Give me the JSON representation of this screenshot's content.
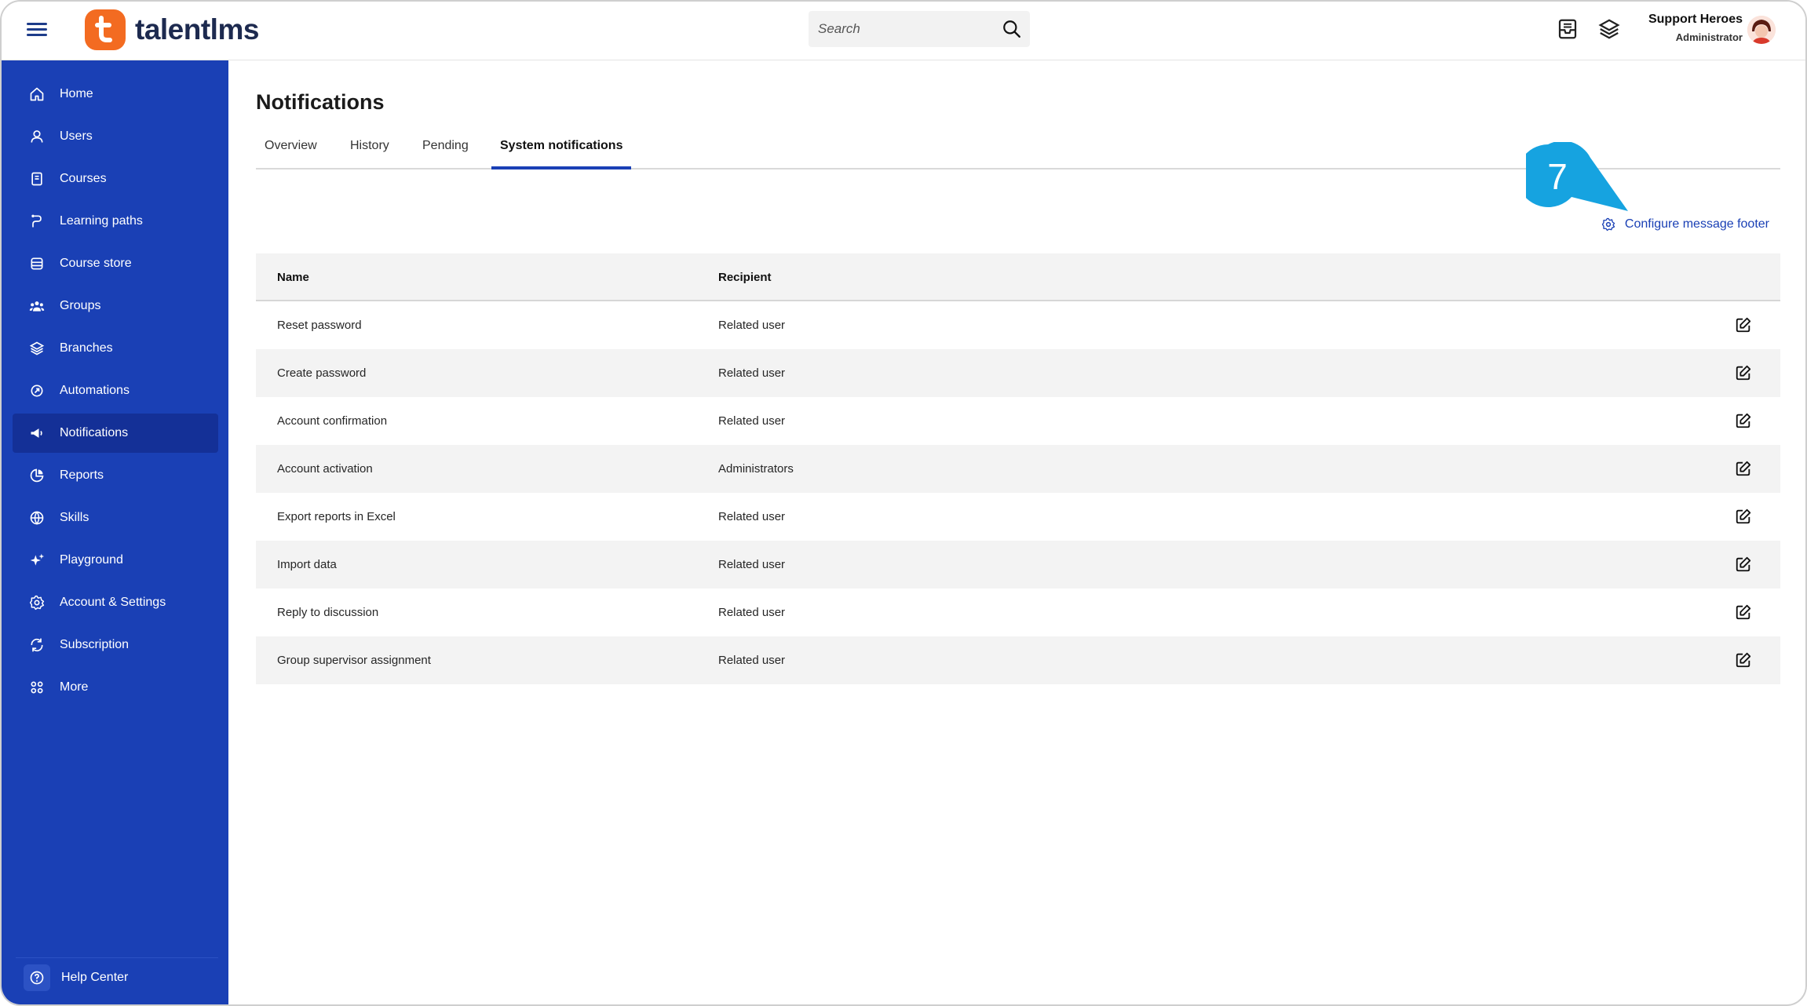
{
  "brand": {
    "name": "talentlms",
    "logo_letter": "t",
    "accent": "#f36b21",
    "sidebar_color": "#1a40b5"
  },
  "search": {
    "placeholder": "Search"
  },
  "user": {
    "name": "Support Heroes",
    "role": "Administrator"
  },
  "sidebar": {
    "items": [
      {
        "label": "Home",
        "icon": "home-icon"
      },
      {
        "label": "Users",
        "icon": "user-icon"
      },
      {
        "label": "Courses",
        "icon": "book-icon"
      },
      {
        "label": "Learning paths",
        "icon": "path-icon"
      },
      {
        "label": "Course store",
        "icon": "store-icon"
      },
      {
        "label": "Groups",
        "icon": "groups-icon"
      },
      {
        "label": "Branches",
        "icon": "layers-icon"
      },
      {
        "label": "Automations",
        "icon": "automation-icon"
      },
      {
        "label": "Notifications",
        "icon": "megaphone-icon",
        "active": true
      },
      {
        "label": "Reports",
        "icon": "pie-chart-icon"
      },
      {
        "label": "Skills",
        "icon": "skills-icon"
      },
      {
        "label": "Playground",
        "icon": "sparkle-icon"
      },
      {
        "label": "Account & Settings",
        "icon": "gear-icon"
      },
      {
        "label": "Subscription",
        "icon": "subscription-icon"
      },
      {
        "label": "More",
        "icon": "grid-icon"
      }
    ],
    "help": "Help Center"
  },
  "page": {
    "title": "Notifications",
    "tabs": [
      "Overview",
      "History",
      "Pending",
      "System notifications"
    ],
    "active_tab": "System notifications",
    "config_link": "Configure message footer",
    "callout_number": "7"
  },
  "table": {
    "headers": [
      "Name",
      "Recipient"
    ],
    "rows": [
      {
        "name": "Reset password",
        "recipient": "Related user"
      },
      {
        "name": "Create password",
        "recipient": "Related user"
      },
      {
        "name": "Account confirmation",
        "recipient": "Related user"
      },
      {
        "name": "Account activation",
        "recipient": "Administrators"
      },
      {
        "name": "Export reports in Excel",
        "recipient": "Related user"
      },
      {
        "name": "Import data",
        "recipient": "Related user"
      },
      {
        "name": "Reply to discussion",
        "recipient": "Related user"
      },
      {
        "name": "Group supervisor assignment",
        "recipient": "Related user"
      }
    ]
  }
}
